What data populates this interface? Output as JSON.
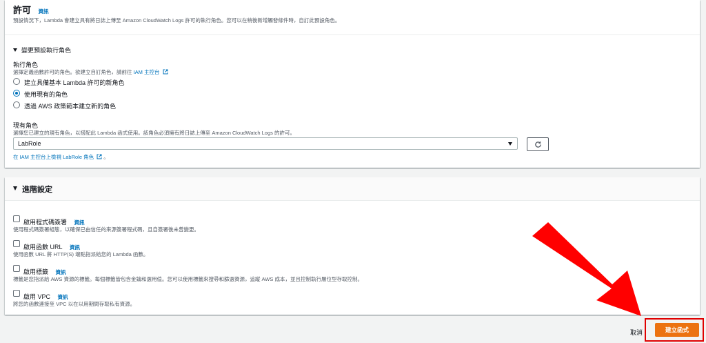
{
  "permissions": {
    "title": "許可",
    "info": "資訊",
    "description": "預設情況下，Lambda 會建立具有將日誌上傳至 Amazon CloudWatch Logs 許可的執行角色。您可以在稍後新增觸發條件時，自訂此預設角色。"
  },
  "change_role": {
    "toggle_label": "變更預設執行角色",
    "exec_role_label": "執行角色",
    "exec_role_desc": "選擇定義函數許可的角色。欲建立自訂角色，請前往",
    "iam_console_link": "IAM 主控台",
    "options": [
      {
        "label": "建立具備基本 Lambda 許可的新角色",
        "checked": false
      },
      {
        "label": "使用現有的角色",
        "checked": true
      },
      {
        "label": "透過 AWS 政策範本建立新的角色",
        "checked": false
      }
    ],
    "existing_role_label": "現有角色",
    "existing_role_desc": "選擇您已建立的現有角色，以搭配此 Lambda 函式使用。該角色必須擁有將日誌上傳至 Amazon CloudWatch Logs 的許可。",
    "selected_role": "LabRole",
    "view_role_link": "在 IAM 主控台上檢視 LabRole 角色"
  },
  "advanced": {
    "title": "進階設定",
    "items": [
      {
        "label": "啟用程式碼簽署",
        "info": "資訊",
        "desc": "使用程式碼簽署組態，以確保已由信任的來源簽署程式碼，且自簽署後未曾變更。"
      },
      {
        "label": "啟用函數 URL",
        "info": "資訊",
        "desc": "使用函數 URL 將 HTTP(S) 端點指派給您的 Lambda 函數。"
      },
      {
        "label": "啟用標籤",
        "info": "資訊",
        "desc": "標籤是您指派給 AWS 資源的標籤。每個標籤皆包含金鑰和選用值。您可以使用標籤來搜尋和篩選資源，追蹤 AWS 成本，並且控制執行層位型存取控制。"
      },
      {
        "label": "啟用 VPC",
        "info": "資訊",
        "desc": "將您的函數連接至 VPC 以在以用期間存取私有資源。"
      }
    ]
  },
  "footer": {
    "cancel": "取消",
    "create": "建立函式"
  },
  "colors": {
    "accent": "#0073bb",
    "primary_button": "#ec7211",
    "annotation_arrow": "#ff0000"
  }
}
